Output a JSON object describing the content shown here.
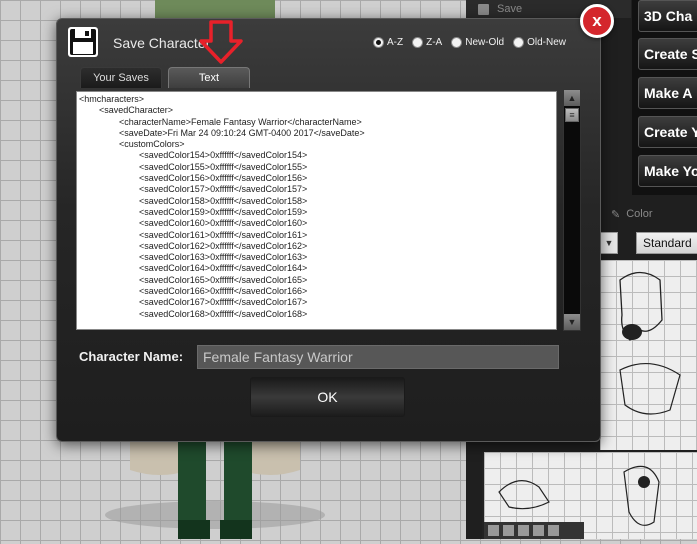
{
  "background": {
    "top_save_label": "Save",
    "menu_buttons": [
      "3D Cha",
      "Create S",
      "Make A",
      "Create Y",
      "Make Yo"
    ],
    "color_tab_label": "Color",
    "standard_dropdown": "Standard"
  },
  "dialog": {
    "title": "Save Character",
    "sort_options": [
      {
        "label": "A-Z",
        "selected": true
      },
      {
        "label": "Z-A",
        "selected": false
      },
      {
        "label": "New-Old",
        "selected": false
      },
      {
        "label": "Old-New",
        "selected": false
      }
    ],
    "tabs": [
      {
        "label": "Your Saves",
        "active": false
      },
      {
        "label": "Text",
        "active": true
      }
    ],
    "xml_text": "<hmcharacters>\n        <savedCharacter>\n                <characterName>Female Fantasy Warrior</characterName>\n                <saveDate>Fri Mar 24 09:10:24 GMT-0400 2017</saveDate>\n                <customColors>\n                        <savedColor154>0xffffff</savedColor154>\n                        <savedColor155>0xffffff</savedColor155>\n                        <savedColor156>0xffffff</savedColor156>\n                        <savedColor157>0xffffff</savedColor157>\n                        <savedColor158>0xffffff</savedColor158>\n                        <savedColor159>0xffffff</savedColor159>\n                        <savedColor160>0xffffff</savedColor160>\n                        <savedColor161>0xffffff</savedColor161>\n                        <savedColor162>0xffffff</savedColor162>\n                        <savedColor163>0xffffff</savedColor163>\n                        <savedColor164>0xffffff</savedColor164>\n                        <savedColor165>0xffffff</savedColor165>\n                        <savedColor166>0xffffff</savedColor166>\n                        <savedColor167>0xffffff</savedColor167>\n                        <savedColor168>0xffffff</savedColor168>",
    "character_name_label": "Character Name:",
    "character_name_value": "Female Fantasy Warrior",
    "ok_label": "OK",
    "close_label": "x"
  },
  "colors": {
    "close_red": "#d4262c",
    "arrow_red": "#e8212a",
    "dialog_bg": "#262626"
  },
  "icons": [
    "floppy-disk-icon",
    "down-arrow-icon",
    "close-icon",
    "scroll-up-icon",
    "scroll-down-icon"
  ]
}
